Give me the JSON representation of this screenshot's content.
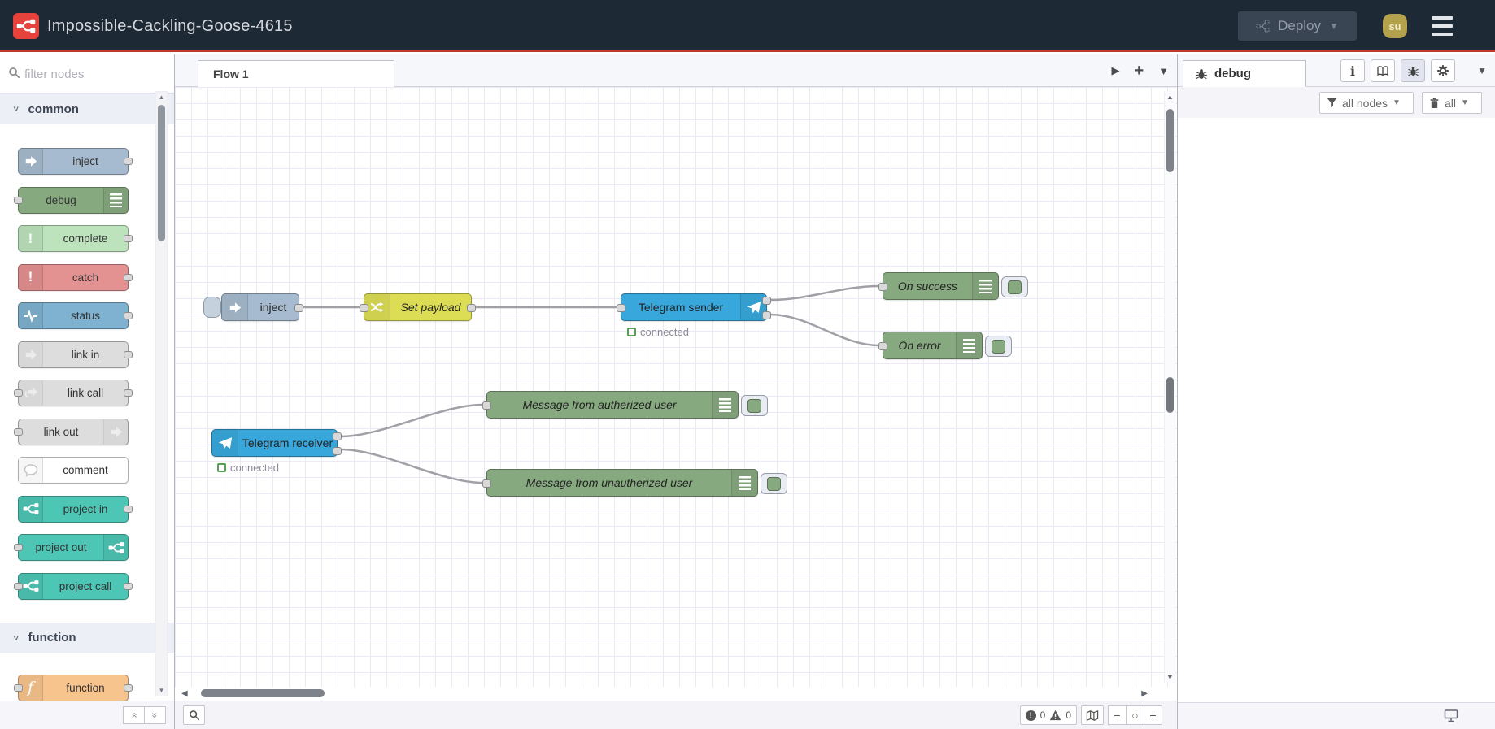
{
  "header": {
    "title": "Impossible-Cackling-Goose-4615",
    "deploy_label": "Deploy",
    "avatar_label": "su"
  },
  "palette": {
    "filter_placeholder": "filter nodes",
    "sections": [
      {
        "label": "common",
        "nodes": [
          {
            "label": "inject",
            "color": "#a6bbcf"
          },
          {
            "label": "debug",
            "color": "#87a980"
          },
          {
            "label": "complete",
            "color": "#bce3bc"
          },
          {
            "label": "catch",
            "color": "#e49191"
          },
          {
            "label": "status",
            "color": "#7fb2d0"
          },
          {
            "label": "link in",
            "color": "#dddddd"
          },
          {
            "label": "link call",
            "color": "#dddddd"
          },
          {
            "label": "link out",
            "color": "#dddddd"
          },
          {
            "label": "comment",
            "color": "#ffffff"
          },
          {
            "label": "project in",
            "color": "#4ec6b5"
          },
          {
            "label": "project out",
            "color": "#4ec6b5"
          },
          {
            "label": "project call",
            "color": "#4ec6b5"
          }
        ]
      },
      {
        "label": "function",
        "nodes": [
          {
            "label": "function",
            "color": "#f8c48e"
          }
        ]
      }
    ]
  },
  "workspace": {
    "tab_label": "Flow 1",
    "nodes": {
      "inject": {
        "label": "inject",
        "color": "#a6bbcf"
      },
      "set_payload": {
        "label": "Set payload",
        "color": "#dcdc55"
      },
      "telegram_sender": {
        "label": "Telegram sender",
        "color": "#38a8dc",
        "status": "connected"
      },
      "on_success": {
        "label": "On success",
        "color": "#87a980"
      },
      "on_error": {
        "label": "On error",
        "color": "#87a980"
      },
      "telegram_receiver": {
        "label": "Telegram receiver",
        "color": "#38a8dc",
        "status": "connected"
      },
      "msg_authorized": {
        "label": "Message from autherized user",
        "color": "#87a980"
      },
      "msg_unauthorized": {
        "label": "Message from unautherized user",
        "color": "#87a980"
      }
    }
  },
  "sidebar": {
    "tab_label": "debug",
    "filter_button_label": "all nodes",
    "clear_button_label": "all"
  },
  "canvas_footer": {
    "error_count": "0",
    "warning_count": "0"
  }
}
